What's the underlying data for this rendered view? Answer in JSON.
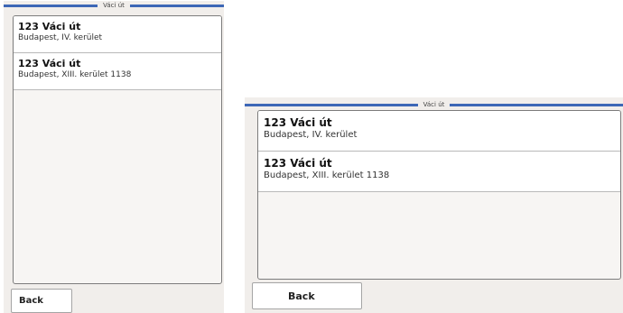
{
  "screens": [
    {
      "title": "Váci út",
      "results": [
        {
          "title": "123 Váci út",
          "subtitle": "Budapest, IV. kerület"
        },
        {
          "title": "123 Váci út",
          "subtitle": "Budapest, XIII. kerület 1138"
        }
      ],
      "back_label": "Back"
    },
    {
      "title": "Váci út",
      "results": [
        {
          "title": "123 Váci út",
          "subtitle": "Budapest, IV. kerület"
        },
        {
          "title": "123 Váci út",
          "subtitle": "Budapest, XIII. kerület 1138"
        }
      ],
      "back_label": "Back"
    }
  ],
  "colors": {
    "title_bar": "#3d67b6",
    "background": "#f1eeeb",
    "list_background": "#f7f5f3",
    "item_background": "#ffffff"
  }
}
